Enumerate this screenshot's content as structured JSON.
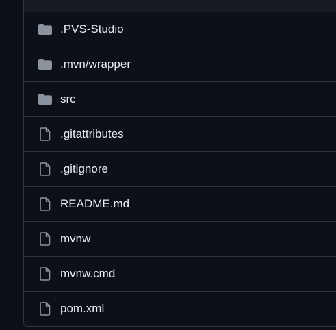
{
  "files": [
    {
      "name": ".PVS-Studio",
      "type": "folder",
      "icon": "folder-icon"
    },
    {
      "name": ".mvn/wrapper",
      "type": "folder",
      "icon": "folder-icon"
    },
    {
      "name": "src",
      "type": "folder",
      "icon": "folder-icon"
    },
    {
      "name": ".gitattributes",
      "type": "file",
      "icon": "file-icon"
    },
    {
      "name": ".gitignore",
      "type": "file",
      "icon": "file-icon"
    },
    {
      "name": "README.md",
      "type": "file",
      "icon": "file-icon"
    },
    {
      "name": "mvnw",
      "type": "file",
      "icon": "file-icon"
    },
    {
      "name": "mvnw.cmd",
      "type": "file",
      "icon": "file-icon"
    },
    {
      "name": "pom.xml",
      "type": "file",
      "icon": "file-icon"
    }
  ],
  "colors": {
    "background": "#0d1117",
    "border": "#30363d",
    "text": "#e6edf3",
    "icon": "#8b949e"
  }
}
